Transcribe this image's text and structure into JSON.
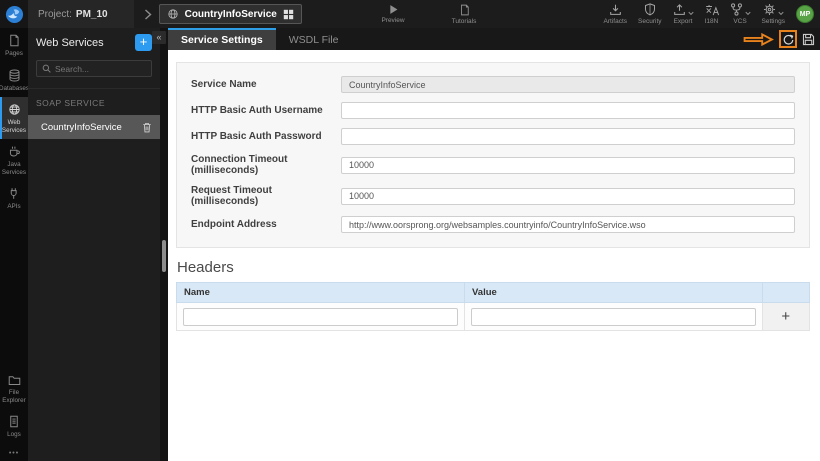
{
  "colors": {
    "accent_blue": "#2d9bf0",
    "annotation_orange": "#e8821c",
    "avatar_green": "#57a345",
    "table_header_blue": "#d9e8f6"
  },
  "topbar": {
    "project_label": "Project:",
    "project_name": "PM_10",
    "service_title": "CountryInfoService",
    "preview_label": "Preview",
    "tutorials_label": "Tutorials",
    "artifacts_label": "Artifacts",
    "security_label": "Security",
    "export_label": "Export",
    "i18n_label": "I18N",
    "vcs_label": "VCS",
    "settings_label": "Settings",
    "avatar_initials": "MP"
  },
  "sidebar": {
    "pages": "Pages",
    "databases": "Databases",
    "web_services": "Web Services",
    "java_services": "Java Services",
    "apis": "APIs",
    "file_explorer": "File Explorer",
    "logs": "Logs",
    "more": "•••"
  },
  "panel": {
    "title": "Web Services",
    "add_label": "+",
    "collapse_label": "«",
    "search_placeholder": "Search...",
    "section": "SOAP SERVICE",
    "service_name": "CountryInfoService"
  },
  "tabs": {
    "service_settings": "Service Settings",
    "wsdl_file": "WSDL File"
  },
  "form": {
    "fields": [
      {
        "label": "Service Name",
        "value": "CountryInfoService",
        "disabled": true
      },
      {
        "label": "HTTP Basic Auth Username",
        "value": ""
      },
      {
        "label": "HTTP Basic Auth Password",
        "value": ""
      },
      {
        "label": "Connection Timeout (milliseconds)",
        "value": "10000"
      },
      {
        "label": "Request Timeout (milliseconds)",
        "value": "10000"
      },
      {
        "label": "Endpoint Address",
        "value": "http://www.oorsprong.org/websamples.countryinfo/CountryInfoService.wso"
      }
    ]
  },
  "headers_section": {
    "title": "Headers",
    "name_column": "Name",
    "value_column": "Value",
    "name_value": "",
    "value_value": "",
    "add_label": "+"
  }
}
